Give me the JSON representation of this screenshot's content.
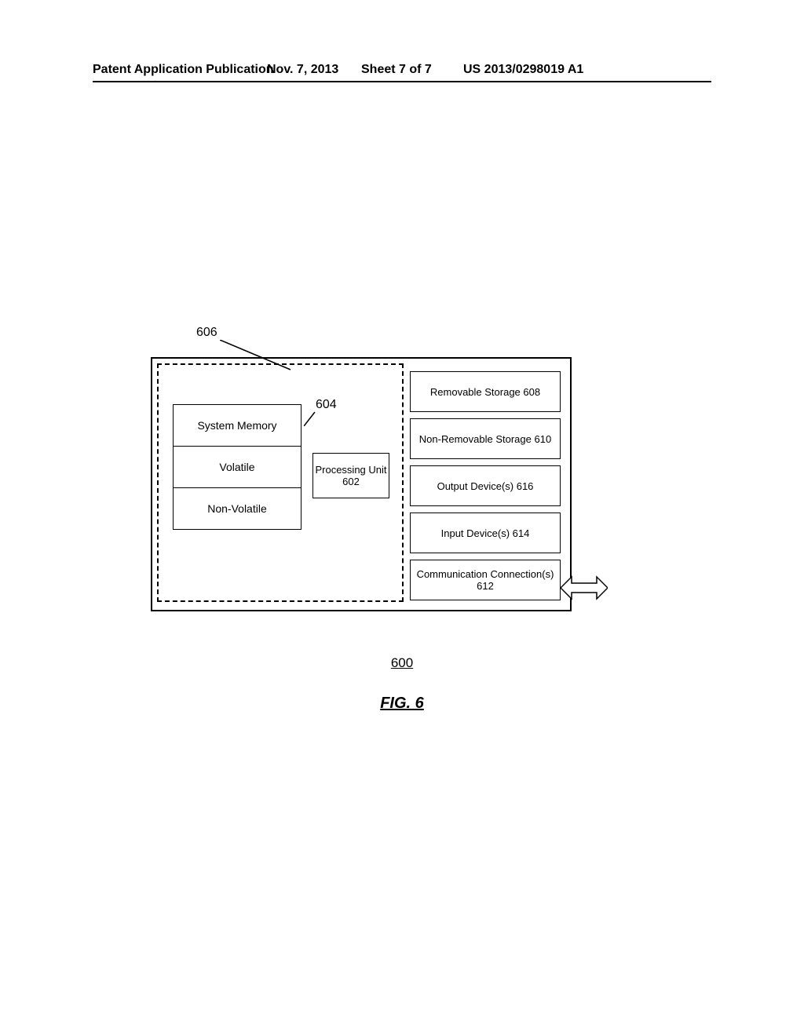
{
  "header": {
    "left": "Patent Application Publication",
    "date": "Nov. 7, 2013",
    "sheet": "Sheet 7 of 7",
    "pubno": "US 2013/0298019 A1"
  },
  "refs": {
    "r606": "606",
    "r604": "604"
  },
  "memory": {
    "row1": "System Memory",
    "row2": "Volatile",
    "row3": "Non-Volatile"
  },
  "processing": "Processing Unit 602",
  "right": {
    "removable": "Removable Storage 608",
    "nonremovable": "Non-Removable Storage 610",
    "output": "Output Device(s) 616",
    "input": "Input Device(s) 614",
    "comm": "Communication Connection(s) 612"
  },
  "figure": {
    "num": "600",
    "caption": "FIG. 6"
  }
}
